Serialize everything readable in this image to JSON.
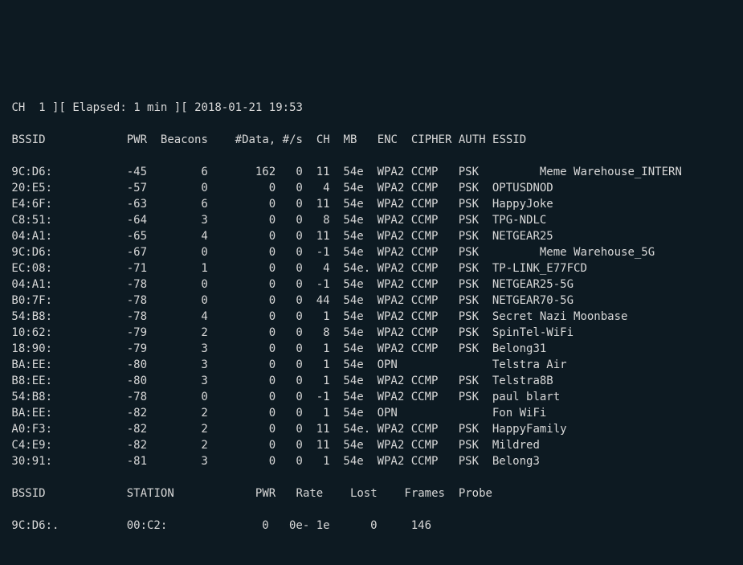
{
  "status": {
    "ch_label": "CH",
    "ch_value": "1",
    "elapsed_label": "Elapsed:",
    "elapsed_value": "1 min",
    "datetime": "2018-01-21 19:53"
  },
  "ap_headers": {
    "bssid": "BSSID",
    "pwr": "PWR",
    "beacons": "Beacons",
    "data": "#Data,",
    "ps": "#/s",
    "ch": "CH",
    "mb": "MB",
    "enc": "ENC",
    "cipher": "CIPHER",
    "auth": "AUTH",
    "essid": "ESSID"
  },
  "aps": [
    {
      "bssid": "9C:D6:",
      "pwr": "-45",
      "beacons": "6",
      "data": "162",
      "ps": "0",
      "ch": "11",
      "mb": "54e",
      "enc": "WPA2",
      "cipher": "CCMP",
      "auth": "PSK",
      "essid": "       Meme Warehouse_INTERN"
    },
    {
      "bssid": "20:E5:",
      "pwr": "-57",
      "beacons": "0",
      "data": "0",
      "ps": "0",
      "ch": "4",
      "mb": "54e",
      "enc": "WPA2",
      "cipher": "CCMP",
      "auth": "PSK",
      "essid": "OPTUSDNOD"
    },
    {
      "bssid": "E4:6F:",
      "pwr": "-63",
      "beacons": "6",
      "data": "0",
      "ps": "0",
      "ch": "11",
      "mb": "54e",
      "enc": "WPA2",
      "cipher": "CCMP",
      "auth": "PSK",
      "essid": "HappyJoke"
    },
    {
      "bssid": "C8:51:",
      "pwr": "-64",
      "beacons": "3",
      "data": "0",
      "ps": "0",
      "ch": "8",
      "mb": "54e",
      "enc": "WPA2",
      "cipher": "CCMP",
      "auth": "PSK",
      "essid": "TPG-NDLC"
    },
    {
      "bssid": "04:A1:",
      "pwr": "-65",
      "beacons": "4",
      "data": "0",
      "ps": "0",
      "ch": "11",
      "mb": "54e",
      "enc": "WPA2",
      "cipher": "CCMP",
      "auth": "PSK",
      "essid": "NETGEAR25"
    },
    {
      "bssid": "9C:D6:",
      "pwr": "-67",
      "beacons": "0",
      "data": "0",
      "ps": "0",
      "ch": "-1",
      "mb": "54e",
      "enc": "WPA2",
      "cipher": "CCMP",
      "auth": "PSK",
      "essid": "       Meme Warehouse_5G"
    },
    {
      "bssid": "EC:08:",
      "pwr": "-71",
      "beacons": "1",
      "data": "0",
      "ps": "0",
      "ch": "4",
      "mb": "54e.",
      "enc": "WPA2",
      "cipher": "CCMP",
      "auth": "PSK",
      "essid": "TP-LINK_E77FCD"
    },
    {
      "bssid": "04:A1:",
      "pwr": "-78",
      "beacons": "0",
      "data": "0",
      "ps": "0",
      "ch": "-1",
      "mb": "54e",
      "enc": "WPA2",
      "cipher": "CCMP",
      "auth": "PSK",
      "essid": "NETGEAR25-5G"
    },
    {
      "bssid": "B0:7F:",
      "pwr": "-78",
      "beacons": "0",
      "data": "0",
      "ps": "0",
      "ch": "44",
      "mb": "54e",
      "enc": "WPA2",
      "cipher": "CCMP",
      "auth": "PSK",
      "essid": "NETGEAR70-5G"
    },
    {
      "bssid": "54:B8:",
      "pwr": "-78",
      "beacons": "4",
      "data": "0",
      "ps": "0",
      "ch": "1",
      "mb": "54e",
      "enc": "WPA2",
      "cipher": "CCMP",
      "auth": "PSK",
      "essid": "Secret Nazi Moonbase"
    },
    {
      "bssid": "10:62:",
      "pwr": "-79",
      "beacons": "2",
      "data": "0",
      "ps": "0",
      "ch": "8",
      "mb": "54e",
      "enc": "WPA2",
      "cipher": "CCMP",
      "auth": "PSK",
      "essid": "SpinTel-WiFi"
    },
    {
      "bssid": "18:90:",
      "pwr": "-79",
      "beacons": "3",
      "data": "0",
      "ps": "0",
      "ch": "1",
      "mb": "54e",
      "enc": "WPA2",
      "cipher": "CCMP",
      "auth": "PSK",
      "essid": "Belong31"
    },
    {
      "bssid": "BA:EE:",
      "pwr": "-80",
      "beacons": "3",
      "data": "0",
      "ps": "0",
      "ch": "1",
      "mb": "54e",
      "enc": "OPN",
      "cipher": "",
      "auth": "",
      "essid": "Telstra Air"
    },
    {
      "bssid": "B8:EE:",
      "pwr": "-80",
      "beacons": "3",
      "data": "0",
      "ps": "0",
      "ch": "1",
      "mb": "54e",
      "enc": "WPA2",
      "cipher": "CCMP",
      "auth": "PSK",
      "essid": "Telstra8B"
    },
    {
      "bssid": "54:B8:",
      "pwr": "-78",
      "beacons": "0",
      "data": "0",
      "ps": "0",
      "ch": "-1",
      "mb": "54e",
      "enc": "WPA2",
      "cipher": "CCMP",
      "auth": "PSK",
      "essid": "paul blart"
    },
    {
      "bssid": "BA:EE:",
      "pwr": "-82",
      "beacons": "2",
      "data": "0",
      "ps": "0",
      "ch": "1",
      "mb": "54e",
      "enc": "OPN",
      "cipher": "",
      "auth": "",
      "essid": "Fon WiFi"
    },
    {
      "bssid": "A0:F3:",
      "pwr": "-82",
      "beacons": "2",
      "data": "0",
      "ps": "0",
      "ch": "11",
      "mb": "54e.",
      "enc": "WPA2",
      "cipher": "CCMP",
      "auth": "PSK",
      "essid": "HappyFamily"
    },
    {
      "bssid": "C4:E9:",
      "pwr": "-82",
      "beacons": "2",
      "data": "0",
      "ps": "0",
      "ch": "11",
      "mb": "54e",
      "enc": "WPA2",
      "cipher": "CCMP",
      "auth": "PSK",
      "essid": "Mildred"
    },
    {
      "bssid": "30:91:",
      "pwr": "-81",
      "beacons": "3",
      "data": "0",
      "ps": "0",
      "ch": "1",
      "mb": "54e",
      "enc": "WPA2",
      "cipher": "CCMP",
      "auth": "PSK",
      "essid": "Belong3"
    }
  ],
  "st_headers": {
    "bssid": "BSSID",
    "station": "STATION",
    "pwr": "PWR",
    "rate": "Rate",
    "lost": "Lost",
    "frames": "Frames",
    "probe": "Probe"
  },
  "stations": [
    {
      "bssid": "9C:D6:.",
      "station": "00:C2:",
      "pwr": "0",
      "rate": "0e- 1e",
      "lost": "0",
      "frames": "146",
      "probe": ""
    }
  ]
}
